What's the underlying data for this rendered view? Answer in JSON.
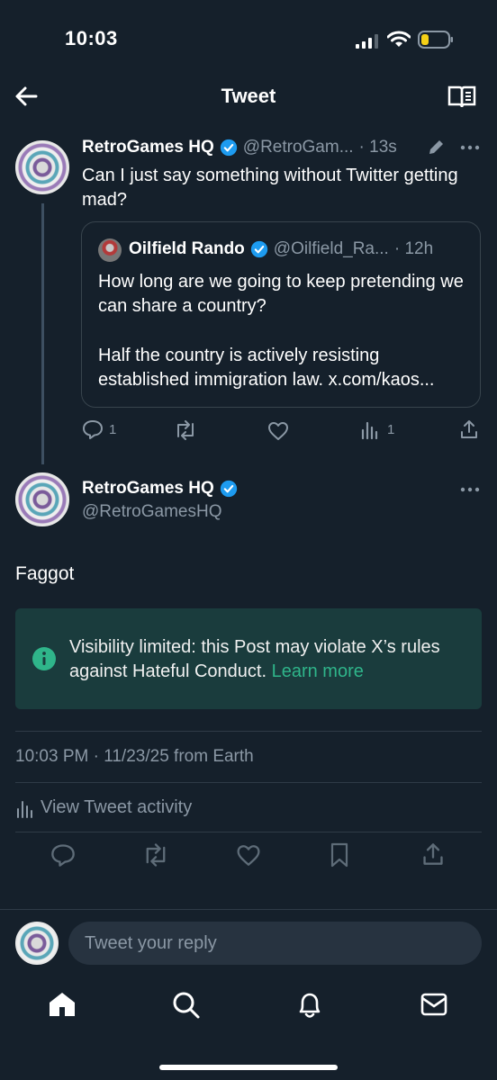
{
  "status_bar": {
    "time": "10:03"
  },
  "header": {
    "title": "Tweet"
  },
  "quoted_parent": {
    "author_name": "RetroGames HQ",
    "author_handle": "@RetroGam...",
    "time": "· 13s",
    "text": "Can I just say something without Twitter getting mad?",
    "quote": {
      "author_name": "Oilfield Rando",
      "author_handle": "@Oilfield_Ra...",
      "time": "· 12h",
      "paragraph1": "How long are we going to keep pretending we can share a country?",
      "paragraph2": "Half the country is actively resisting established immigration law. x.com/kaos..."
    },
    "actions": {
      "replies": "1",
      "views": "1"
    }
  },
  "main_tweet": {
    "author_name": "RetroGames HQ",
    "author_handle": "@RetroGamesHQ",
    "text": "Faggot",
    "notice": {
      "text": "Visibility limited: this Post may violate X’s rules against Hateful Conduct.",
      "link": "Learn more"
    },
    "meta": "10:03 PM · 11/23/25 from Earth",
    "activity_label": "View Tweet activity"
  },
  "reply": {
    "placeholder": "Tweet your reply"
  },
  "colors": {
    "background": "#15202b",
    "verified": "#1d9bf0",
    "link": "#2fb58a",
    "notice_bg": "#1a3c3d"
  },
  "icons": [
    "back-arrow-icon",
    "reader-icon",
    "verified-badge-icon",
    "edit-icon",
    "more-icon",
    "reply-icon",
    "retweet-icon",
    "like-icon",
    "views-icon",
    "share-icon",
    "info-icon",
    "bookmark-icon",
    "home-icon",
    "search-icon",
    "notifications-icon",
    "messages-icon"
  ]
}
